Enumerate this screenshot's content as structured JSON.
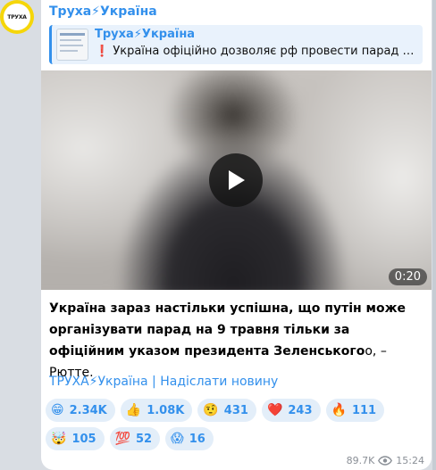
{
  "avatar": {
    "text": "ТРУХА"
  },
  "channel": {
    "name": "Труха⚡Україна"
  },
  "reply": {
    "title": "Труха⚡Україна",
    "text": "❗ Україна офіційно дозволяє рф провести парад на 9…"
  },
  "video": {
    "duration": "0:20"
  },
  "message": {
    "bold_text": "Україна зараз настільки успішна, що путін може організувати парад на 9 травня тільки за офіційним указом президента Зеленського",
    "tail_text": "о, – Рютте."
  },
  "footer_link": "ТРУХА⚡Україна | Надіслати новину",
  "reactions": {
    "row1": [
      {
        "emoji": "😁",
        "count": "2.34K"
      },
      {
        "emoji": "👍",
        "count": "1.08K"
      },
      {
        "emoji": "🤨",
        "count": "431"
      },
      {
        "emoji": "❤️",
        "count": "243"
      },
      {
        "emoji": "🔥",
        "count": "111"
      }
    ],
    "row2": [
      {
        "emoji": "🤯",
        "count": "105"
      },
      {
        "emoji": "💯",
        "count": "52"
      },
      {
        "emoji": "😱",
        "count": "16"
      }
    ]
  },
  "meta": {
    "views": "89.7K",
    "time": "15:24"
  },
  "colors": {
    "accent": "#3390ec",
    "reaction_bg": "#e3eef9"
  }
}
